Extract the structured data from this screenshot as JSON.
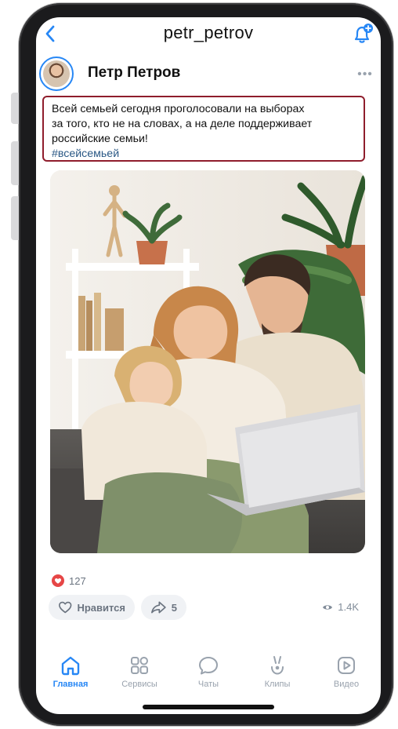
{
  "header": {
    "title": "petr_petrov",
    "back_icon": "chevron-left-icon",
    "add_notification_icon": "bell-plus-icon"
  },
  "author": {
    "name": "Петр Петров",
    "more_icon": "more-horizontal-icon"
  },
  "post": {
    "text_lines": [
      "Всей семьей сегодня проголосовали на выборах",
      "за того, кто не на словах, а на деле поддерживает",
      "российские семьи!"
    ],
    "hashtag": "#всейсемьей"
  },
  "stats": {
    "likes_count": "127",
    "like_button_label": "Нравится",
    "share_count": "5",
    "views_count": "1.4K"
  },
  "tabbar": {
    "items": [
      {
        "label": "Главная",
        "icon": "home-icon",
        "active": true
      },
      {
        "label": "Сервисы",
        "icon": "services-grid-icon",
        "active": false
      },
      {
        "label": "Чаты",
        "icon": "chat-bubble-icon",
        "active": false
      },
      {
        "label": "Клипы",
        "icon": "clips-icon",
        "active": false
      },
      {
        "label": "Видео",
        "icon": "video-play-icon",
        "active": false
      }
    ]
  },
  "colors": {
    "accent": "#2787f5",
    "post_border": "#8f1d2c",
    "hashtag": "#2a5885",
    "like_heart": "#e64646"
  }
}
